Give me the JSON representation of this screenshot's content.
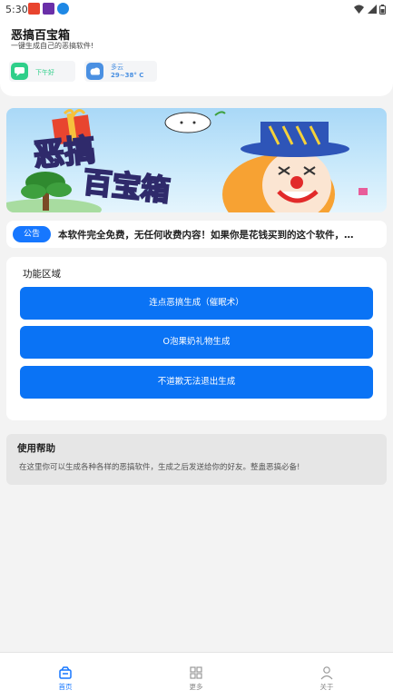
{
  "status_bar": {
    "time": "5:30"
  },
  "header": {
    "title": "恶搞百宝箱",
    "subtitle": "一键生成自己的恶搞软件!",
    "greeting_chip": {
      "label": "下午好",
      "color": "#2fcf8a"
    },
    "weather_chip": {
      "condition": "多云",
      "temperature": "29~38° C",
      "color": "#4a90e2"
    }
  },
  "banner": {
    "title_line1": "恶搞",
    "title_line2": "百宝箱"
  },
  "notice": {
    "badge": "公告",
    "text": "本软件完全免费，无任何收费内容！如果你是花钱买到的这个软件，…"
  },
  "functions": {
    "section_title": "功能区域",
    "buttons": [
      {
        "label": "连点恶搞生成（催眠术）"
      },
      {
        "label": "O泡果奶礼物生成"
      },
      {
        "label": "不道歉无法退出生成"
      }
    ]
  },
  "help": {
    "title": "使用帮助",
    "text": "在这里你可以生成各种各样的恶搞软件，生成之后发送给你的好友。整蛊恶搞必备!"
  },
  "bottom_nav": {
    "items": [
      {
        "label": "首页",
        "icon": "home-icon",
        "active": true
      },
      {
        "label": "更多",
        "icon": "grid-icon",
        "active": false
      },
      {
        "label": "关于",
        "icon": "person-icon",
        "active": false
      }
    ]
  },
  "colors": {
    "accent": "#1677ff",
    "button": "#0a73f5",
    "background": "#f3f3f3"
  }
}
